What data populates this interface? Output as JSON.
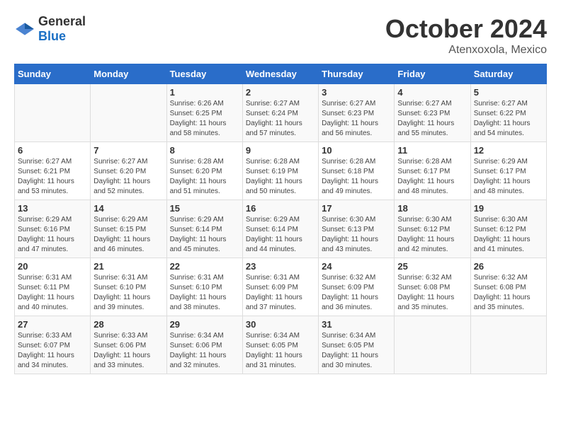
{
  "header": {
    "logo_general": "General",
    "logo_blue": "Blue",
    "month_year": "October 2024",
    "location": "Atenxoxola, Mexico"
  },
  "calendar": {
    "days_of_week": [
      "Sunday",
      "Monday",
      "Tuesday",
      "Wednesday",
      "Thursday",
      "Friday",
      "Saturday"
    ],
    "weeks": [
      [
        {
          "day": "",
          "info": ""
        },
        {
          "day": "",
          "info": ""
        },
        {
          "day": "1",
          "info": "Sunrise: 6:26 AM\nSunset: 6:25 PM\nDaylight: 11 hours and 58 minutes."
        },
        {
          "day": "2",
          "info": "Sunrise: 6:27 AM\nSunset: 6:24 PM\nDaylight: 11 hours and 57 minutes."
        },
        {
          "day": "3",
          "info": "Sunrise: 6:27 AM\nSunset: 6:23 PM\nDaylight: 11 hours and 56 minutes."
        },
        {
          "day": "4",
          "info": "Sunrise: 6:27 AM\nSunset: 6:23 PM\nDaylight: 11 hours and 55 minutes."
        },
        {
          "day": "5",
          "info": "Sunrise: 6:27 AM\nSunset: 6:22 PM\nDaylight: 11 hours and 54 minutes."
        }
      ],
      [
        {
          "day": "6",
          "info": "Sunrise: 6:27 AM\nSunset: 6:21 PM\nDaylight: 11 hours and 53 minutes."
        },
        {
          "day": "7",
          "info": "Sunrise: 6:27 AM\nSunset: 6:20 PM\nDaylight: 11 hours and 52 minutes."
        },
        {
          "day": "8",
          "info": "Sunrise: 6:28 AM\nSunset: 6:20 PM\nDaylight: 11 hours and 51 minutes."
        },
        {
          "day": "9",
          "info": "Sunrise: 6:28 AM\nSunset: 6:19 PM\nDaylight: 11 hours and 50 minutes."
        },
        {
          "day": "10",
          "info": "Sunrise: 6:28 AM\nSunset: 6:18 PM\nDaylight: 11 hours and 49 minutes."
        },
        {
          "day": "11",
          "info": "Sunrise: 6:28 AM\nSunset: 6:17 PM\nDaylight: 11 hours and 48 minutes."
        },
        {
          "day": "12",
          "info": "Sunrise: 6:29 AM\nSunset: 6:17 PM\nDaylight: 11 hours and 48 minutes."
        }
      ],
      [
        {
          "day": "13",
          "info": "Sunrise: 6:29 AM\nSunset: 6:16 PM\nDaylight: 11 hours and 47 minutes."
        },
        {
          "day": "14",
          "info": "Sunrise: 6:29 AM\nSunset: 6:15 PM\nDaylight: 11 hours and 46 minutes."
        },
        {
          "day": "15",
          "info": "Sunrise: 6:29 AM\nSunset: 6:14 PM\nDaylight: 11 hours and 45 minutes."
        },
        {
          "day": "16",
          "info": "Sunrise: 6:29 AM\nSunset: 6:14 PM\nDaylight: 11 hours and 44 minutes."
        },
        {
          "day": "17",
          "info": "Sunrise: 6:30 AM\nSunset: 6:13 PM\nDaylight: 11 hours and 43 minutes."
        },
        {
          "day": "18",
          "info": "Sunrise: 6:30 AM\nSunset: 6:12 PM\nDaylight: 11 hours and 42 minutes."
        },
        {
          "day": "19",
          "info": "Sunrise: 6:30 AM\nSunset: 6:12 PM\nDaylight: 11 hours and 41 minutes."
        }
      ],
      [
        {
          "day": "20",
          "info": "Sunrise: 6:31 AM\nSunset: 6:11 PM\nDaylight: 11 hours and 40 minutes."
        },
        {
          "day": "21",
          "info": "Sunrise: 6:31 AM\nSunset: 6:10 PM\nDaylight: 11 hours and 39 minutes."
        },
        {
          "day": "22",
          "info": "Sunrise: 6:31 AM\nSunset: 6:10 PM\nDaylight: 11 hours and 38 minutes."
        },
        {
          "day": "23",
          "info": "Sunrise: 6:31 AM\nSunset: 6:09 PM\nDaylight: 11 hours and 37 minutes."
        },
        {
          "day": "24",
          "info": "Sunrise: 6:32 AM\nSunset: 6:09 PM\nDaylight: 11 hours and 36 minutes."
        },
        {
          "day": "25",
          "info": "Sunrise: 6:32 AM\nSunset: 6:08 PM\nDaylight: 11 hours and 35 minutes."
        },
        {
          "day": "26",
          "info": "Sunrise: 6:32 AM\nSunset: 6:08 PM\nDaylight: 11 hours and 35 minutes."
        }
      ],
      [
        {
          "day": "27",
          "info": "Sunrise: 6:33 AM\nSunset: 6:07 PM\nDaylight: 11 hours and 34 minutes."
        },
        {
          "day": "28",
          "info": "Sunrise: 6:33 AM\nSunset: 6:06 PM\nDaylight: 11 hours and 33 minutes."
        },
        {
          "day": "29",
          "info": "Sunrise: 6:34 AM\nSunset: 6:06 PM\nDaylight: 11 hours and 32 minutes."
        },
        {
          "day": "30",
          "info": "Sunrise: 6:34 AM\nSunset: 6:05 PM\nDaylight: 11 hours and 31 minutes."
        },
        {
          "day": "31",
          "info": "Sunrise: 6:34 AM\nSunset: 6:05 PM\nDaylight: 11 hours and 30 minutes."
        },
        {
          "day": "",
          "info": ""
        },
        {
          "day": "",
          "info": ""
        }
      ]
    ]
  }
}
